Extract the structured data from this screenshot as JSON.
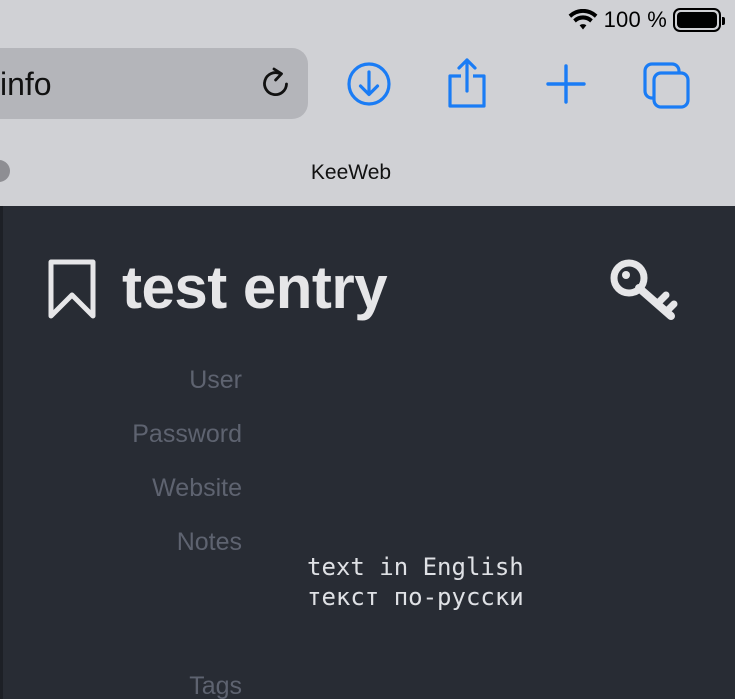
{
  "status": {
    "battery_percent": "100 %",
    "battery_level": 1.0
  },
  "browser": {
    "url_text": "info",
    "tab_title": "KeeWeb",
    "icons": [
      "reload-icon",
      "download-icon",
      "share-icon",
      "plus-icon",
      "tabs-icon"
    ],
    "accent_color": "#1a7cf5"
  },
  "entry": {
    "title": "test entry",
    "fields": {
      "user_label": "User",
      "password_label": "Password",
      "website_label": "Website",
      "notes_label": "Notes",
      "tags_label": "Tags"
    },
    "notes_lines": [
      "text in English",
      "текст по-русски"
    ],
    "icons": [
      "bookmark-icon",
      "key-icon"
    ]
  },
  "theme": {
    "app_background": "#282c34",
    "label_color": "#5e6370",
    "title_color": "#e6e6e8"
  }
}
